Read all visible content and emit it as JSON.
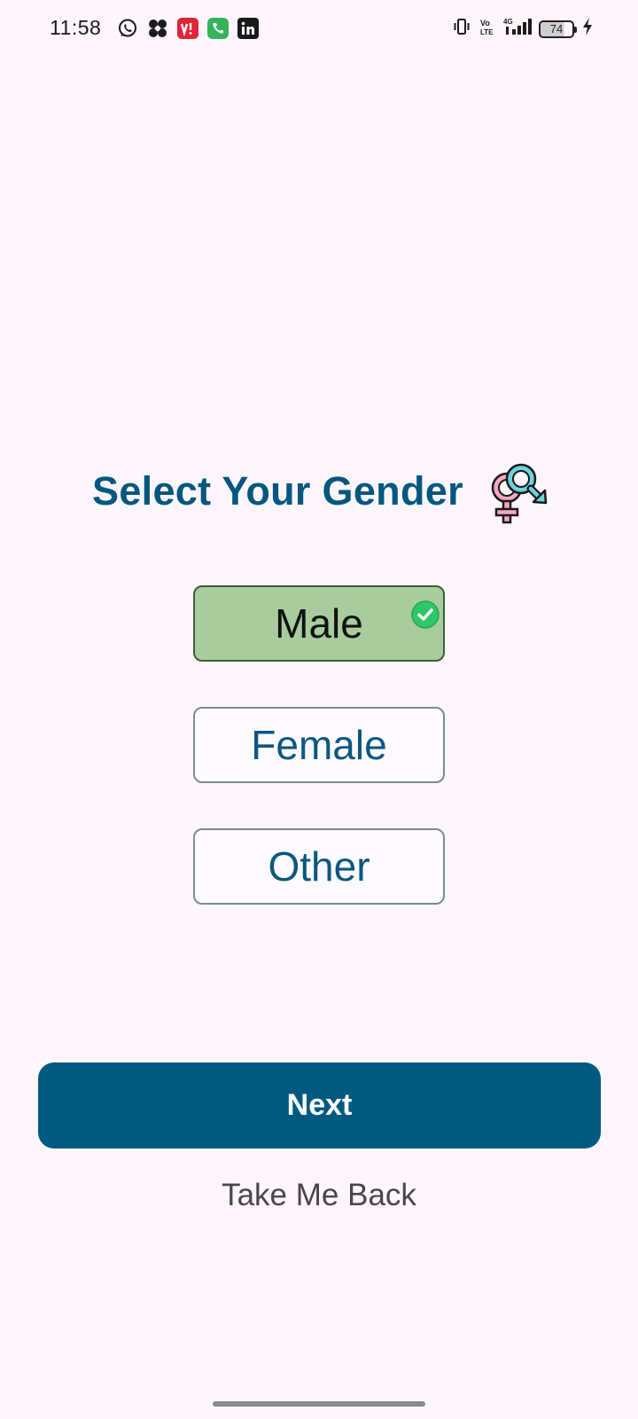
{
  "status_bar": {
    "time": "11:58",
    "notification_icons": [
      "whatsapp-icon",
      "pinwheel-app-icon",
      "vi-app-icon",
      "phone-call-icon",
      "linkedin-icon"
    ],
    "system_icons": [
      "vibrate-icon",
      "volte-icon",
      "4g-signal-icon",
      "battery-icon",
      "charging-icon"
    ],
    "battery_level": "74"
  },
  "header": {
    "title": "Select Your Gender",
    "icon": "gender-symbol-icon"
  },
  "options": [
    {
      "label": "Male",
      "selected": true
    },
    {
      "label": "Female",
      "selected": false
    },
    {
      "label": "Other",
      "selected": false
    }
  ],
  "actions": {
    "next_label": "Next",
    "back_label": "Take Me Back"
  },
  "colors": {
    "primary": "#005a80",
    "title": "#04577e",
    "selected_fill": "#a9cc9f",
    "background": "#fcf6fc"
  }
}
